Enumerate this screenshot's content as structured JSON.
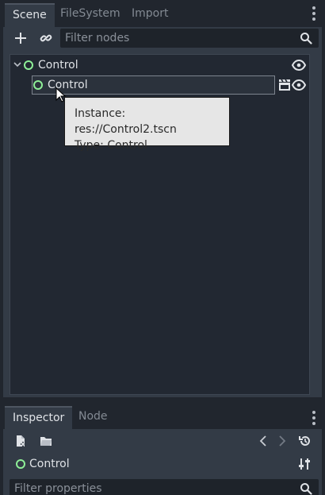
{
  "scene_dock": {
    "tabs": [
      "Scene",
      "FileSystem",
      "Import"
    ],
    "active_tab": "Scene",
    "filter_placeholder": "Filter nodes",
    "tree": {
      "root": {
        "label": "Control",
        "type_icon": "control-node-icon",
        "visibility_icon": "eye-icon"
      },
      "child": {
        "label": "Control",
        "type_icon": "control-node-icon",
        "instance_icon": "clapperboard-icon",
        "visibility_icon": "eye-icon"
      }
    },
    "tooltip": {
      "line1": "Instance: res://Control2.tscn",
      "line2": "Type: Control"
    }
  },
  "inspector_dock": {
    "tabs": [
      "Inspector",
      "Node"
    ],
    "active_tab": "Inspector",
    "selected_node": "Control",
    "filter_placeholder": "Filter properties"
  },
  "colors": {
    "control_node": "#8eef97",
    "panel": "#333b46",
    "background": "#21262e"
  }
}
